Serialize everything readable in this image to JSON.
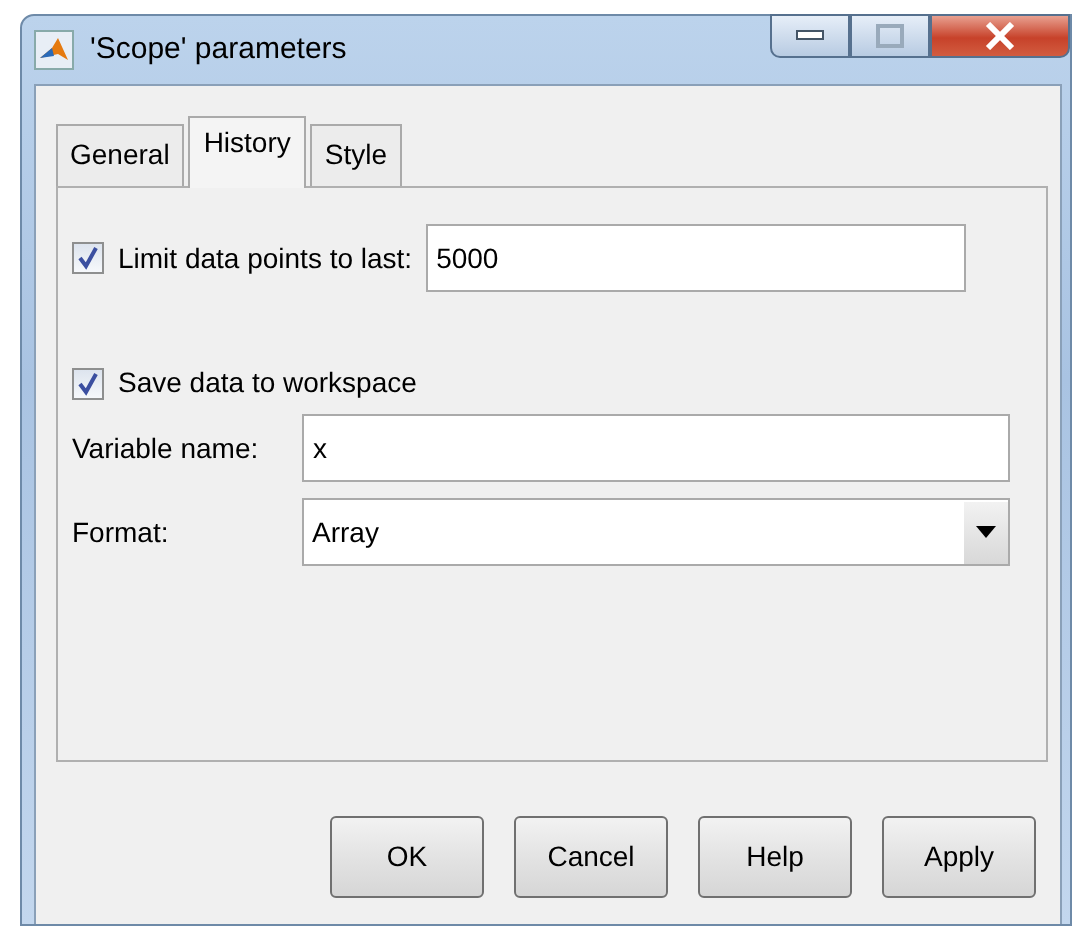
{
  "window": {
    "title": "'Scope' parameters"
  },
  "tabs": [
    {
      "label": "General",
      "selected": false
    },
    {
      "label": "History",
      "selected": true
    },
    {
      "label": "Style",
      "selected": false
    }
  ],
  "limit": {
    "label": "Limit data points to last:",
    "checked": true,
    "value": "5000"
  },
  "save": {
    "label": "Save data to workspace",
    "checked": true
  },
  "variable": {
    "label": "Variable name:",
    "value": "x"
  },
  "format": {
    "label": "Format:",
    "value": "Array"
  },
  "buttons": [
    "OK",
    "Cancel",
    "Help",
    "Apply"
  ]
}
